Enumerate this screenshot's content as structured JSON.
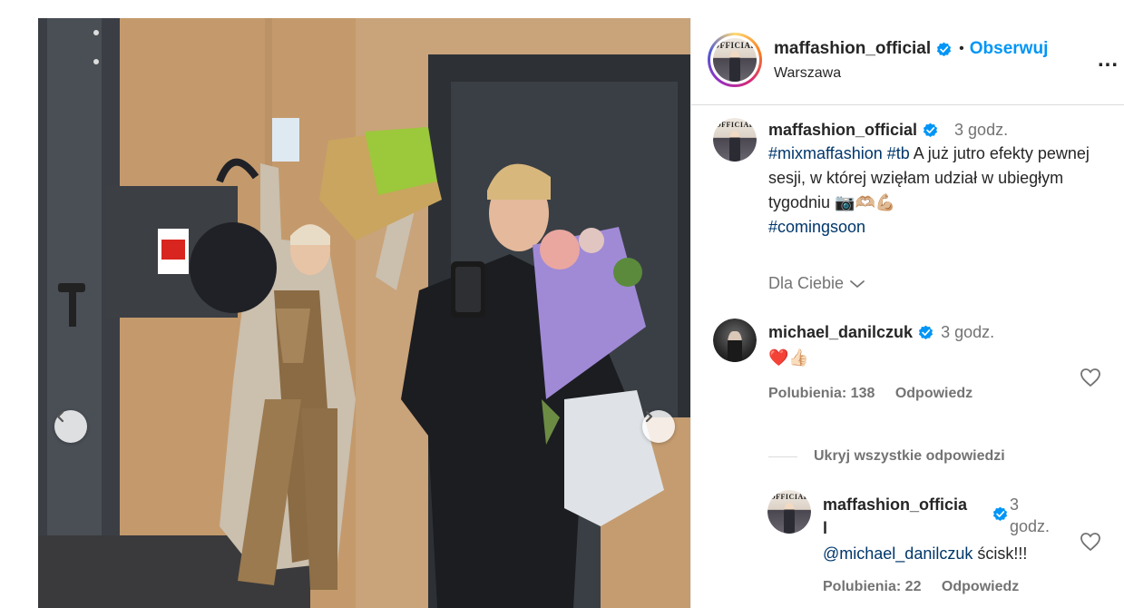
{
  "post": {
    "author": "maffashion_official",
    "follow_label": "Obserwuj",
    "location": "Warszawa",
    "separator": "•",
    "more_label": "..."
  },
  "caption": {
    "author": "maffashion_official",
    "time": "3 godz.",
    "hashtag_1": "#mixmaffashion",
    "hashtag_2": "#tb",
    "text": "A już jutro efekty pewnej sesji, w której wzięłam udział w ubiegłym tygodniu",
    "emojis": "📷🫶🏼💪🏼",
    "hashtag_3": "#comingsoon"
  },
  "filter": {
    "label": "Dla Ciebie"
  },
  "comment": {
    "author": "michael_danilczuk",
    "time": "3 godz.",
    "emojis": "❤️👍🏻",
    "likes": "Polubienia: 138",
    "reply_label": "Odpowiedz"
  },
  "hide_replies_label": "Ukryj wszystkie odpowiedzi",
  "reply": {
    "author_line_1": "maffashion_officia",
    "author_line_2": "l",
    "time_line_1": "3",
    "time_line_2": "godz.",
    "mention": "@michael_danilczuk",
    "text": "ścisk!!!",
    "likes": "Polubienia: 22",
    "reply_label": "Odpowiedz"
  },
  "avatar_masthead": "OFFICIAL",
  "colors": {
    "accent": "#0095f6",
    "verified": "#0095f6",
    "muted": "#737373",
    "link": "#00376b"
  }
}
